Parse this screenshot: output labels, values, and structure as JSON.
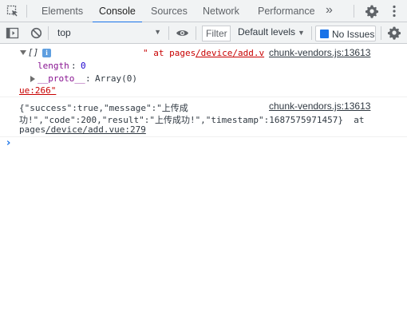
{
  "tabs": {
    "items": [
      {
        "label": "Elements"
      },
      {
        "label": "Console"
      },
      {
        "label": "Sources"
      },
      {
        "label": "Network"
      },
      {
        "label": "Performance"
      }
    ],
    "more": "»"
  },
  "toolbar": {
    "context": "top",
    "filter_placeholder": "Filter",
    "levels": "Default levels",
    "issues": "No Issues"
  },
  "console": {
    "entry1": {
      "label": "[]",
      "info_badge": "i",
      "message": "\" at pages",
      "link": "/device/add.v",
      "continuation": "ue:266\"",
      "source": "chunk-vendors.js:13613",
      "length_key": "length",
      "length_value": "0",
      "proto_key": "__proto__",
      "proto_value": "Array(0)"
    },
    "entry2": {
      "line1": "{\"success\":true,\"message\":\"上传成",
      "line2": "功!\",\"code\":200,\"result\":\"上传成功!\",\"timestamp\":1687575971457}  at",
      "line3_prefix": "pages",
      "line3_link": "/device/add.vue:279",
      "source": "chunk-vendors.js:13613"
    },
    "prompt": "›"
  },
  "colors": {
    "accent": "#1a73e8",
    "toolbar_bg": "#f1f3f4",
    "string_red": "#c80000",
    "property": "#881391",
    "number": "#1c00cf"
  }
}
